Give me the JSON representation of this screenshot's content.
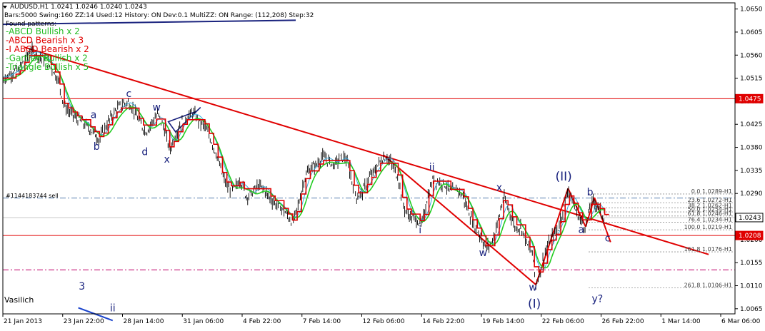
{
  "colors": {
    "background": "#ffffff",
    "bar": "#000000",
    "red_line": "#e00000",
    "green_line": "#22cc22",
    "cyan_line": "#33aadd",
    "navy": "#1a237e",
    "dashdot_blue": "#5a80b0",
    "dashdot_magenta": "#c0006a",
    "price_box_bg": "#ffffff",
    "red_box_bg": "#e00000"
  },
  "header": {
    "symbol_line": "AUDUSD,H1  1.0241 1.0246 1.0240 1.0243",
    "params_line": "Bars:5000  Swing:160  ZZ:14  Used:12  History: ON Dev:0.1  MultiZZ: ON  Range: (112,208)  Step:32",
    "found_label": "Found patterns:"
  },
  "patterns": [
    {
      "label": "-ABCD Bullish x 2",
      "color": "#22bb22"
    },
    {
      "label": "-ABCD Bearish x 3",
      "color": "#e00000"
    },
    {
      "label": "-I ABCD Bearish x 2",
      "color": "#e00000"
    },
    {
      "label": "-Gartley Bullish x 2",
      "color": "#22bb22"
    },
    {
      "label": "-Triangle Bullish x 5",
      "color": "#22bb22"
    }
  ],
  "signature": "Vasilich",
  "order_label": "#1144183744 sell",
  "chart_data": {
    "type": "line",
    "symbol": "AUDUSD",
    "timeframe": "H1",
    "ylim": [
      1.0055,
      1.0662
    ],
    "y_ticks": [
      "1.0650",
      "1.0605",
      "1.0560",
      "1.0515",
      "1.0470",
      "1.0425",
      "1.0380",
      "1.0335",
      "1.0290",
      "1.0245",
      "1.0200",
      "1.0155",
      "1.0110",
      "1.0065"
    ],
    "x_labels": [
      "21 Jan 2013",
      "23 Jan 22:00",
      "28 Jan 14:00",
      "31 Jan 06:00",
      "4 Feb 22:00",
      "7 Feb 14:00",
      "12 Feb 06:00",
      "14 Feb 22:00",
      "19 Feb 14:00",
      "22 Feb 06:00",
      "26 Feb 22:00",
      "1 Mar 14:00",
      "6 Mar 06:00"
    ],
    "x_range": [
      0,
      1000
    ],
    "close": [
      [
        0,
        1.0515
      ],
      [
        8,
        1.052
      ],
      [
        15,
        1.0528
      ],
      [
        22,
        1.053
      ],
      [
        30,
        1.0552
      ],
      [
        38,
        1.057
      ],
      [
        45,
        1.0562
      ],
      [
        52,
        1.0555
      ],
      [
        60,
        1.0548
      ],
      [
        68,
        1.0532
      ],
      [
        76,
        1.051
      ],
      [
        84,
        1.046
      ],
      [
        92,
        1.0448
      ],
      [
        100,
        1.0438
      ],
      [
        108,
        1.0428
      ],
      [
        116,
        1.042
      ],
      [
        124,
        1.0408
      ],
      [
        132,
        1.0395
      ],
      [
        140,
        1.042
      ],
      [
        148,
        1.044
      ],
      [
        156,
        1.0455
      ],
      [
        164,
        1.0465
      ],
      [
        172,
        1.0468
      ],
      [
        180,
        1.0448
      ],
      [
        188,
        1.0425
      ],
      [
        196,
        1.041
      ],
      [
        204,
        1.043
      ],
      [
        212,
        1.0445
      ],
      [
        220,
        1.0418
      ],
      [
        228,
        1.0375
      ],
      [
        236,
        1.0405
      ],
      [
        244,
        1.0428
      ],
      [
        252,
        1.044
      ],
      [
        260,
        1.0448
      ],
      [
        268,
        1.043
      ],
      [
        276,
        1.042
      ],
      [
        284,
        1.0395
      ],
      [
        292,
        1.0365
      ],
      [
        300,
        1.0325
      ],
      [
        308,
        1.03
      ],
      [
        316,
        1.0298
      ],
      [
        324,
        1.0318
      ],
      [
        332,
        1.0285
      ],
      [
        340,
        1.029
      ],
      [
        348,
        1.0305
      ],
      [
        356,
        1.03
      ],
      [
        364,
        1.0282
      ],
      [
        372,
        1.027
      ],
      [
        380,
        1.0262
      ],
      [
        388,
        1.0248
      ],
      [
        396,
        1.0232
      ],
      [
        404,
        1.027
      ],
      [
        412,
        1.032
      ],
      [
        420,
        1.034
      ],
      [
        428,
        1.0345
      ],
      [
        436,
        1.0362
      ],
      [
        444,
        1.0355
      ],
      [
        452,
        1.0345
      ],
      [
        460,
        1.0358
      ],
      [
        468,
        1.036
      ],
      [
        476,
        1.0318
      ],
      [
        484,
        1.0282
      ],
      [
        492,
        1.0295
      ],
      [
        500,
        1.032
      ],
      [
        508,
        1.0335
      ],
      [
        516,
        1.0355
      ],
      [
        524,
        1.0362
      ],
      [
        532,
        1.0345
      ],
      [
        540,
        1.032
      ],
      [
        548,
        1.0262
      ],
      [
        556,
        1.0245
      ],
      [
        564,
        1.024
      ],
      [
        572,
        1.0228
      ],
      [
        580,
        1.0282
      ],
      [
        588,
        1.032
      ],
      [
        596,
        1.0312
      ],
      [
        604,
        1.0308
      ],
      [
        612,
        1.0292
      ],
      [
        620,
        1.03
      ],
      [
        628,
        1.0285
      ],
      [
        636,
        1.0255
      ],
      [
        644,
        1.0225
      ],
      [
        652,
        1.0208
      ],
      [
        660,
        1.0182
      ],
      [
        668,
        1.0195
      ],
      [
        676,
        1.0235
      ],
      [
        684,
        1.0282
      ],
      [
        692,
        1.0255
      ],
      [
        700,
        1.0222
      ],
      [
        708,
        1.0225
      ],
      [
        716,
        1.019
      ],
      [
        724,
        1.017
      ],
      [
        728,
        1.0112
      ],
      [
        734,
        1.014
      ],
      [
        742,
        1.018
      ],
      [
        750,
        1.0205
      ],
      [
        758,
        1.022
      ],
      [
        766,
        1.0262
      ],
      [
        772,
        1.03
      ],
      [
        780,
        1.0265
      ],
      [
        788,
        1.024
      ],
      [
        796,
        1.0225
      ],
      [
        804,
        1.0275
      ],
      [
        812,
        1.0268
      ],
      [
        818,
        1.0248
      ],
      [
        822,
        1.0243
      ]
    ],
    "horizontal_levels": [
      {
        "price": 1.0475,
        "style": "solid",
        "color": "#e00000",
        "label": "1.0475"
      },
      {
        "price": 1.0208,
        "style": "solid",
        "color": "#e00000",
        "label": "1.0208"
      },
      {
        "price": 1.0243,
        "style": "solid",
        "color": "#c8c8c8",
        "label": "1.0243"
      },
      {
        "price": 1.0281,
        "style": "dashdot",
        "color": "#5a80b0"
      },
      {
        "price": 1.0141,
        "style": "dashdot",
        "color": "#c0006a"
      }
    ],
    "trendlines": [
      {
        "from": [
          30,
          1.0575
        ],
        "to": [
          964,
          1.0171
        ],
        "color": "#e00000"
      },
      {
        "from": [
          520,
          1.0365
        ],
        "to": [
          728,
          1.0112
        ],
        "color": "#e00000"
      },
      {
        "from": [
          728,
          1.0112
        ],
        "to": [
          772,
          1.03
        ],
        "color": "#e00000"
      },
      {
        "from": [
          772,
          1.03
        ],
        "to": [
          796,
          1.0225
        ],
        "color": "#e00000"
      },
      {
        "from": [
          796,
          1.0225
        ],
        "to": [
          808,
          1.0282
        ],
        "color": "#e00000"
      },
      {
        "from": [
          808,
          1.0282
        ],
        "to": [
          830,
          1.0195
        ],
        "color": "#e00000"
      },
      {
        "from": [
          0,
          1.062
        ],
        "to": [
          400,
          1.0628
        ],
        "color": "#1a237e"
      },
      {
        "from": [
          103,
          1.0067
        ],
        "to": [
          150,
          1.0042
        ],
        "color": "#1a44cc"
      }
    ],
    "fibonacci": [
      {
        "label": "0.0  1.0289-H1",
        "price": 1.0289
      },
      {
        "label": "23.6  1.0272-H1",
        "price": 1.0272
      },
      {
        "label": "38.2  1.0262-H1",
        "price": 1.0262
      },
      {
        "label": "50.0  1.0254-H1",
        "price": 1.0254
      },
      {
        "label": "61.8  1.0246-H1",
        "price": 1.0246
      },
      {
        "label": "76.4  1.0234-H1",
        "price": 1.0234
      },
      {
        "label": "100.0  1.0219-H1",
        "price": 1.0219
      },
      {
        "label": "161.8  1.0176-H1",
        "price": 1.0176
      },
      {
        "label": "261.8  1.0106-H1",
        "price": 1.0106
      }
    ],
    "wave_labels": [
      {
        "text": "a",
        "x": 124,
        "price": 1.0437,
        "size": "normal"
      },
      {
        "text": "b",
        "x": 128,
        "price": 1.0375,
        "size": "normal"
      },
      {
        "text": "c",
        "x": 172,
        "price": 1.0478,
        "size": "normal"
      },
      {
        "text": "d",
        "x": 194,
        "price": 1.0365,
        "size": "normal"
      },
      {
        "text": "w",
        "x": 210,
        "price": 1.0452,
        "size": "normal"
      },
      {
        "text": "x",
        "x": 224,
        "price": 1.035,
        "size": "normal"
      },
      {
        "text": "ii",
        "x": 586,
        "price": 1.0335,
        "size": "normal"
      },
      {
        "text": "i",
        "x": 570,
        "price": 1.0212,
        "size": "normal"
      },
      {
        "text": "x",
        "x": 678,
        "price": 1.0295,
        "size": "normal"
      },
      {
        "text": "w",
        "x": 656,
        "price": 1.0168,
        "size": "normal"
      },
      {
        "text": "w",
        "x": 724,
        "price": 1.01,
        "size": "normal"
      },
      {
        "text": "(I)",
        "x": 726,
        "price": 1.0067,
        "size": "big"
      },
      {
        "text": "(II)",
        "x": 766,
        "price": 1.0315,
        "size": "big"
      },
      {
        "text": "b",
        "x": 802,
        "price": 1.0286,
        "size": "normal"
      },
      {
        "text": "a",
        "x": 790,
        "price": 1.0213,
        "size": "normal"
      },
      {
        "text": "c",
        "x": 826,
        "price": 1.0196,
        "size": "normal"
      },
      {
        "text": "y?",
        "x": 812,
        "price": 1.0078,
        "size": "normal"
      },
      {
        "text": "3",
        "x": 108,
        "price": 1.0102,
        "size": "normal"
      },
      {
        "text": "ii",
        "x": 150,
        "price": 1.006,
        "size": "normal"
      }
    ],
    "triangle_pattern": [
      [
        226,
        1.043
      ],
      [
        264,
        1.045
      ],
      [
        270,
        1.0458
      ],
      [
        236,
        1.041
      ]
    ],
    "triangle_color": "#1a237e"
  }
}
